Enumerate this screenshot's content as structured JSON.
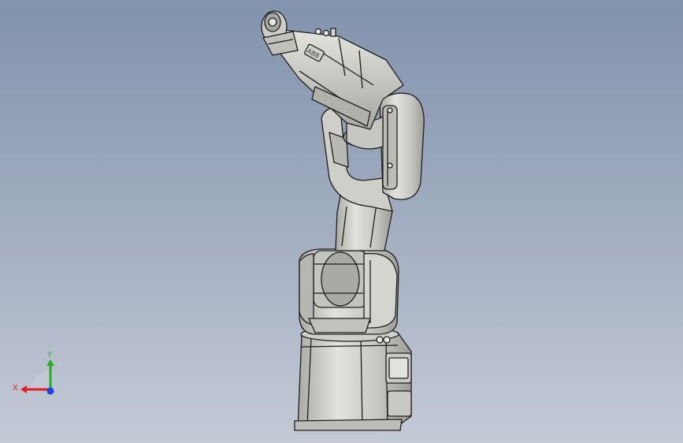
{
  "viewport": {
    "background_top": "#8193ad",
    "background_bottom": "#c4cad6"
  },
  "model": {
    "name": "six-axis-robot-arm",
    "body_color": "#d9d9d4",
    "shade_color": "#b4b4ae",
    "edge_color": "#1e1e1e",
    "arm_logo_text": "ABB"
  },
  "triad": {
    "x_label": "X",
    "y_label": "Y",
    "x_color": "#e02020",
    "y_color": "#22b022",
    "z_color": "#2040e0"
  }
}
